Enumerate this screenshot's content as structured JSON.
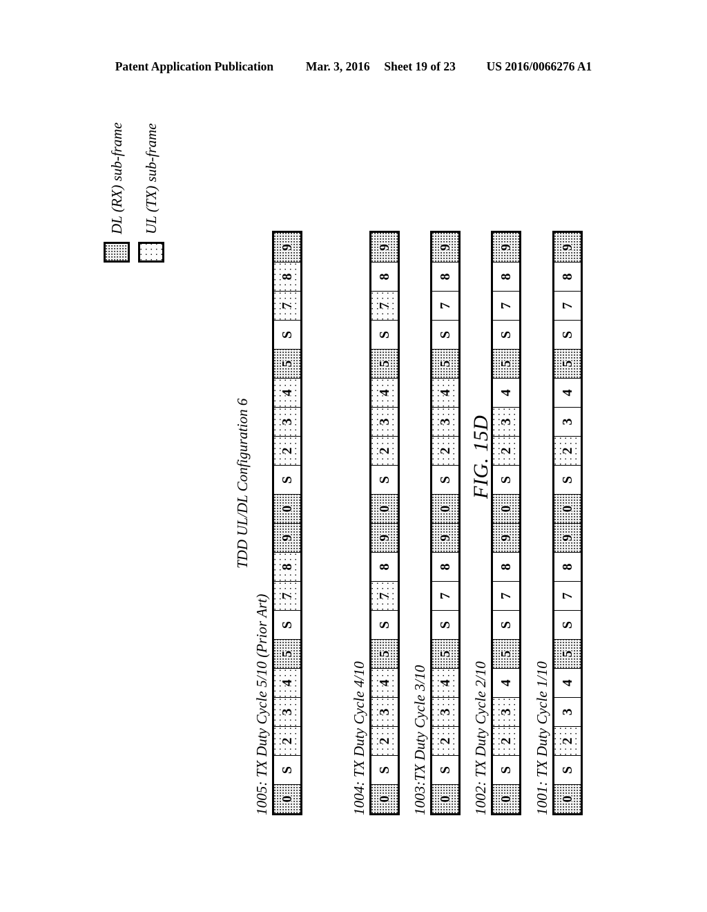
{
  "header": {
    "publication": "Patent Application Publication",
    "date": "Mar. 3, 2016",
    "sheet": "Sheet 19 of 23",
    "number": "US 2016/0066276 A1"
  },
  "figure": {
    "number": "FIG. 15D",
    "tdd_caption": "TDD UL/DL Configuration 6"
  },
  "legend": {
    "items": [
      {
        "key": "dl",
        "swatch": "dense-dot-swatch",
        "label": "DL (RX) sub-frame"
      },
      {
        "key": "ul",
        "swatch": "sparse-dot-swatch",
        "label": "UL (TX) sub-frame"
      }
    ]
  },
  "subframe_labels": [
    "0",
    "S",
    "2",
    "3",
    "4",
    "5",
    "S",
    "7",
    "8",
    "9",
    "0",
    "S",
    "2",
    "3",
    "4",
    "5",
    "S",
    "7",
    "8",
    "9"
  ],
  "rows": [
    {
      "id": "1001",
      "label": "1001: TX Duty Cycle 1/10",
      "cells": [
        {
          "t": "0",
          "k": "dl"
        },
        {
          "t": "S",
          "k": "none"
        },
        {
          "t": "2",
          "k": "ul"
        },
        {
          "t": "3",
          "k": "none"
        },
        {
          "t": "4",
          "k": "none"
        },
        {
          "t": "5",
          "k": "dl"
        },
        {
          "t": "S",
          "k": "none"
        },
        {
          "t": "7",
          "k": "none"
        },
        {
          "t": "8",
          "k": "none"
        },
        {
          "t": "9",
          "k": "dl"
        },
        {
          "t": "0",
          "k": "dl"
        },
        {
          "t": "S",
          "k": "none"
        },
        {
          "t": "2",
          "k": "ul"
        },
        {
          "t": "3",
          "k": "none"
        },
        {
          "t": "4",
          "k": "none"
        },
        {
          "t": "5",
          "k": "dl"
        },
        {
          "t": "S",
          "k": "none"
        },
        {
          "t": "7",
          "k": "none"
        },
        {
          "t": "8",
          "k": "none"
        },
        {
          "t": "9",
          "k": "dl"
        }
      ]
    },
    {
      "id": "1002",
      "label": "1002: TX Duty Cycle 2/10",
      "cells": [
        {
          "t": "0",
          "k": "dl"
        },
        {
          "t": "S",
          "k": "none"
        },
        {
          "t": "2",
          "k": "ul"
        },
        {
          "t": "3",
          "k": "ul"
        },
        {
          "t": "4",
          "k": "none"
        },
        {
          "t": "5",
          "k": "dl"
        },
        {
          "t": "S",
          "k": "none"
        },
        {
          "t": "7",
          "k": "none"
        },
        {
          "t": "8",
          "k": "none"
        },
        {
          "t": "9",
          "k": "dl"
        },
        {
          "t": "0",
          "k": "dl"
        },
        {
          "t": "S",
          "k": "none"
        },
        {
          "t": "2",
          "k": "ul"
        },
        {
          "t": "3",
          "k": "ul"
        },
        {
          "t": "4",
          "k": "none"
        },
        {
          "t": "5",
          "k": "dl"
        },
        {
          "t": "S",
          "k": "none"
        },
        {
          "t": "7",
          "k": "none"
        },
        {
          "t": "8",
          "k": "none"
        },
        {
          "t": "9",
          "k": "dl"
        }
      ]
    },
    {
      "id": "1003",
      "label": "1003:TX Duty Cycle 3/10",
      "cells": [
        {
          "t": "0",
          "k": "dl"
        },
        {
          "t": "S",
          "k": "none"
        },
        {
          "t": "2",
          "k": "ul"
        },
        {
          "t": "3",
          "k": "ul"
        },
        {
          "t": "4",
          "k": "ul"
        },
        {
          "t": "5",
          "k": "dl"
        },
        {
          "t": "S",
          "k": "none"
        },
        {
          "t": "7",
          "k": "none"
        },
        {
          "t": "8",
          "k": "none"
        },
        {
          "t": "9",
          "k": "dl"
        },
        {
          "t": "0",
          "k": "dl"
        },
        {
          "t": "S",
          "k": "none"
        },
        {
          "t": "2",
          "k": "ul"
        },
        {
          "t": "3",
          "k": "ul"
        },
        {
          "t": "4",
          "k": "ul"
        },
        {
          "t": "5",
          "k": "dl"
        },
        {
          "t": "S",
          "k": "none"
        },
        {
          "t": "7",
          "k": "none"
        },
        {
          "t": "8",
          "k": "none"
        },
        {
          "t": "9",
          "k": "dl"
        }
      ]
    },
    {
      "id": "1004",
      "label": "1004: TX Duty Cycle 4/10",
      "cells": [
        {
          "t": "0",
          "k": "dl"
        },
        {
          "t": "S",
          "k": "none"
        },
        {
          "t": "2",
          "k": "ul"
        },
        {
          "t": "3",
          "k": "ul"
        },
        {
          "t": "4",
          "k": "ul"
        },
        {
          "t": "5",
          "k": "dl"
        },
        {
          "t": "S",
          "k": "none"
        },
        {
          "t": "7",
          "k": "ul"
        },
        {
          "t": "8",
          "k": "none"
        },
        {
          "t": "9",
          "k": "dl"
        },
        {
          "t": "0",
          "k": "dl"
        },
        {
          "t": "S",
          "k": "none"
        },
        {
          "t": "2",
          "k": "ul"
        },
        {
          "t": "3",
          "k": "ul"
        },
        {
          "t": "4",
          "k": "ul"
        },
        {
          "t": "5",
          "k": "dl"
        },
        {
          "t": "S",
          "k": "none"
        },
        {
          "t": "7",
          "k": "ul"
        },
        {
          "t": "8",
          "k": "none"
        },
        {
          "t": "9",
          "k": "dl"
        }
      ]
    },
    {
      "id": "1005",
      "label": "1005: TX Duty Cycle 5/10 (Prior Art)",
      "cells": [
        {
          "t": "0",
          "k": "dl"
        },
        {
          "t": "S",
          "k": "none"
        },
        {
          "t": "2",
          "k": "ul"
        },
        {
          "t": "3",
          "k": "ul"
        },
        {
          "t": "4",
          "k": "ul"
        },
        {
          "t": "5",
          "k": "dl"
        },
        {
          "t": "S",
          "k": "none"
        },
        {
          "t": "7",
          "k": "ul"
        },
        {
          "t": "8",
          "k": "ul"
        },
        {
          "t": "9",
          "k": "dl"
        },
        {
          "t": "0",
          "k": "dl"
        },
        {
          "t": "S",
          "k": "none"
        },
        {
          "t": "2",
          "k": "ul"
        },
        {
          "t": "3",
          "k": "ul"
        },
        {
          "t": "4",
          "k": "ul"
        },
        {
          "t": "5",
          "k": "dl"
        },
        {
          "t": "S",
          "k": "none"
        },
        {
          "t": "7",
          "k": "ul"
        },
        {
          "t": "8",
          "k": "ul"
        },
        {
          "t": "9",
          "k": "dl"
        }
      ]
    }
  ]
}
